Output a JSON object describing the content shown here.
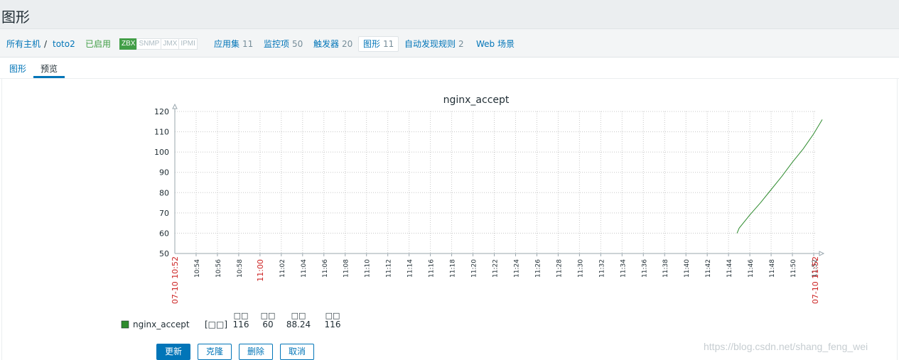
{
  "page": {
    "title": "图形"
  },
  "navbar": {
    "all_hosts": "所有主机",
    "separator": "/",
    "host": "toto2",
    "status": "已启用",
    "badges": [
      "ZBX",
      "SNMP",
      "JMX",
      "IPMI"
    ],
    "items": [
      {
        "label": "应用集",
        "count": "11"
      },
      {
        "label": "监控项",
        "count": "50"
      },
      {
        "label": "触发器",
        "count": "20"
      },
      {
        "label": "图形",
        "count": "11"
      },
      {
        "label": "自动发现规则",
        "count": "2"
      },
      {
        "label": "Web 场景",
        "count": ""
      }
    ]
  },
  "tabs": {
    "graph": "图形",
    "preview": "预览"
  },
  "buttons": {
    "update": "更新",
    "clone": "克隆",
    "delete": "删除",
    "cancel": "取消"
  },
  "watermark": "https://blog.csdn.net/shang_feng_wei",
  "colors": {
    "series": "#2e8b2e",
    "axis_date": "#cc2222",
    "link": "#0275b8"
  },
  "chart_data": {
    "type": "line",
    "title": "nginx_accept",
    "ylim": [
      50,
      120
    ],
    "y_ticks": [
      50,
      60,
      70,
      80,
      90,
      100,
      110,
      120
    ],
    "x_ticks": [
      "10:54",
      "10:56",
      "10:58",
      "11:00",
      "11:02",
      "11:04",
      "11:06",
      "11:08",
      "11:10",
      "11:12",
      "11:14",
      "11:16",
      "11:18",
      "11:20",
      "11:22",
      "11:24",
      "11:26",
      "11:28",
      "11:30",
      "11:32",
      "11:34",
      "11:36",
      "11:38",
      "11:40",
      "11:42",
      "11:44",
      "11:46",
      "11:48",
      "11:50",
      "11:52"
    ],
    "x_start_label": "07-10 10:52",
    "x_end_label": "07-10 11:52",
    "grid": true,
    "series": [
      {
        "name": "nginx_accept",
        "x": [
          "11:44:48",
          "11:45:00",
          "11:46:00",
          "11:47:00",
          "11:48:00",
          "11:49:00",
          "11:50:00",
          "11:51:00",
          "11:52:00",
          "11:52:48"
        ],
        "values": [
          60,
          62.5,
          69,
          75,
          81.5,
          88,
          95,
          101.5,
          109,
          116
        ]
      }
    ],
    "legend": {
      "name": "nginx_accept",
      "func": "[□□]",
      "headers": [
        "□□",
        "□□",
        "□□",
        "□□"
      ],
      "values": [
        "116",
        "60",
        "88.24",
        "116"
      ]
    }
  }
}
